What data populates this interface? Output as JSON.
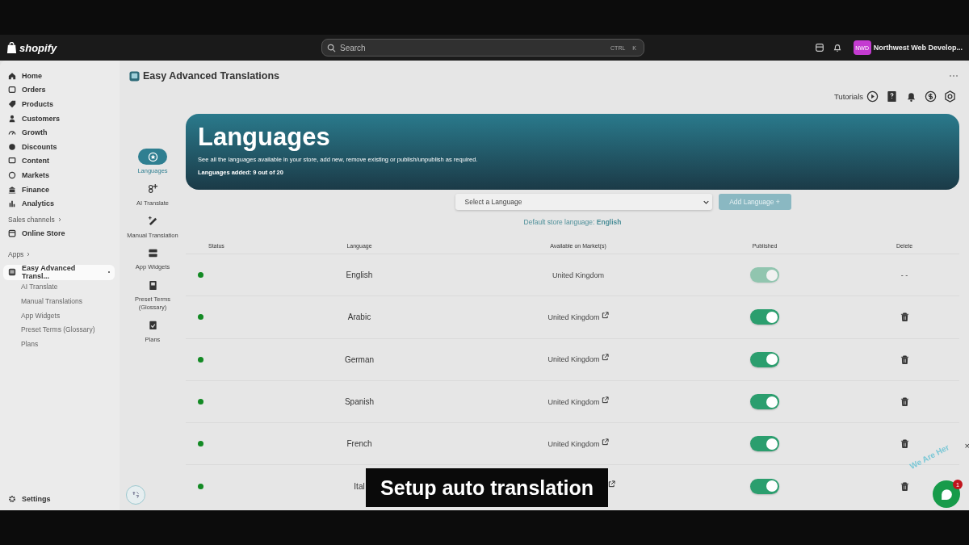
{
  "topbar": {
    "brand": "shopify",
    "search_placeholder": "Search",
    "shortcut_keys": [
      "CTRL",
      "K"
    ],
    "store_initials": "NWD",
    "store_name": "Northwest Web Develop..."
  },
  "sidebar": {
    "items": [
      {
        "label": "Home"
      },
      {
        "label": "Orders"
      },
      {
        "label": "Products"
      },
      {
        "label": "Customers"
      },
      {
        "label": "Growth"
      },
      {
        "label": "Discounts"
      },
      {
        "label": "Content"
      },
      {
        "label": "Markets"
      },
      {
        "label": "Finance"
      },
      {
        "label": "Analytics"
      }
    ],
    "sales_channels": "Sales channels",
    "online_store": "Online Store",
    "apps": "Apps",
    "app": {
      "label": "Easy Advanced Transl...",
      "selected": true,
      "children": [
        {
          "label": "AI Translate"
        },
        {
          "label": "Manual Translations"
        },
        {
          "label": "App Widgets"
        },
        {
          "label": "Preset Terms (Glossary)"
        },
        {
          "label": "Plans"
        }
      ]
    },
    "settings": "Settings"
  },
  "app_title": "Easy Advanced Translations",
  "app_nav": [
    {
      "label": "Languages",
      "selected": true
    },
    {
      "label": "AI Translate",
      "selected": false
    },
    {
      "label": "Manual Translation",
      "selected": false
    },
    {
      "label": "App Widgets",
      "selected": false
    },
    {
      "label": "Preset Terms (Glossary)",
      "selected": false
    },
    {
      "label": "Plans",
      "selected": false
    }
  ],
  "toolbar": {
    "tutorials": "Tutorials"
  },
  "hero": {
    "title": "Languages",
    "description": "See all the languages available in your store, add new, remove existing or publish/unpublish as required.",
    "count": "Languages added: 9 out of 20"
  },
  "language_select": {
    "placeholder": "Select a Language"
  },
  "add_button": {
    "label": "Add Language +",
    "disabled": true
  },
  "default_language": "Default store language: **English**",
  "table": {
    "columns": [
      "Status",
      "Language",
      "Available on Market(s)",
      "Published",
      "Delete"
    ],
    "rows": [
      {
        "active": true,
        "language": "English",
        "market": "United Kingdom",
        "external": false,
        "published": true,
        "disabled": true,
        "delete": "- -"
      },
      {
        "active": true,
        "language": "Arabic",
        "market": "United Kingdom",
        "external": true,
        "published": true,
        "disabled": false
      },
      {
        "active": true,
        "language": "German",
        "market": "United Kingdom",
        "external": true,
        "published": true,
        "disabled": false
      },
      {
        "active": true,
        "language": "Spanish",
        "market": "United Kingdom",
        "external": true,
        "published": true,
        "disabled": false
      },
      {
        "active": true,
        "language": "French",
        "market": "United Kingdom",
        "external": true,
        "published": true,
        "disabled": false
      },
      {
        "active": true,
        "language": "Ital",
        "external": true,
        "published": true,
        "disabled": false
      }
    ]
  },
  "caption": "Setup auto translation",
  "chat_widget": {
    "label": "We Are Her",
    "badge": "1",
    "close": "×"
  }
}
